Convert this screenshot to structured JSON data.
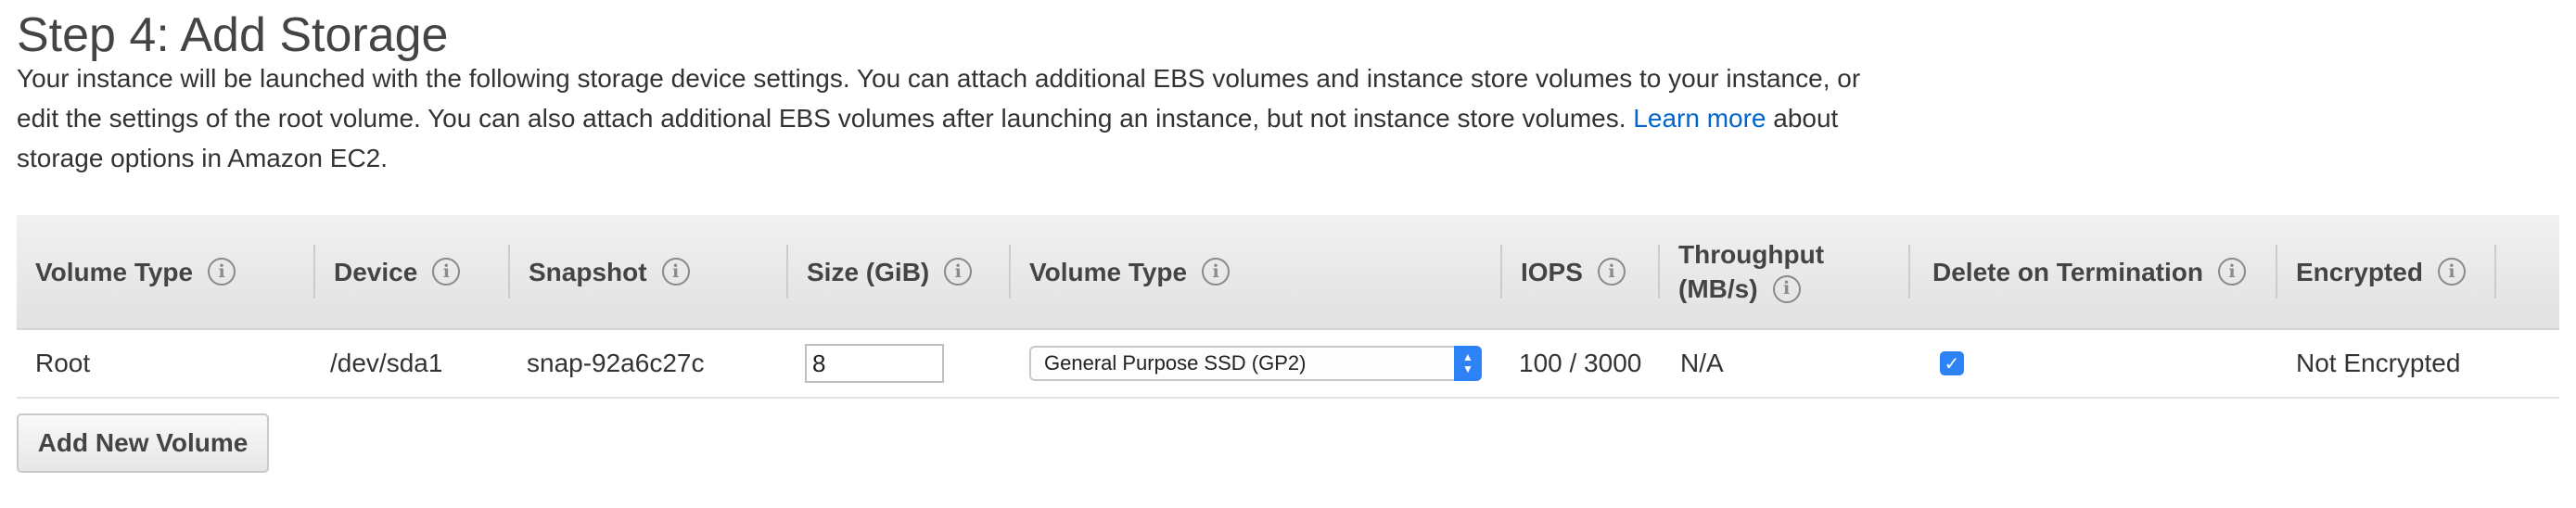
{
  "page": {
    "title": "Step 4: Add Storage",
    "description_line1": "Your instance will be launched with the following storage device settings. You can attach additional EBS volumes and instance store volumes to your instance, or",
    "description_line2_pre": "edit the settings of the root volume. You can also attach additional EBS volumes after launching an instance, but not instance store volumes.",
    "learn_more_link": "Learn more",
    "description_line2_post": "about",
    "description_line3": "storage options in Amazon EC2."
  },
  "table": {
    "headers": {
      "volume_type": "Volume Type",
      "device": "Device",
      "snapshot": "Snapshot",
      "size": "Size (GiB)",
      "volume_type_select": "Volume Type",
      "iops": "IOPS",
      "throughput_line1": "Throughput",
      "throughput_line2": "(MB/s)",
      "delete_on_termination": "Delete on Termination",
      "encrypted": "Encrypted"
    },
    "row": {
      "volume_type": "Root",
      "device": "/dev/sda1",
      "snapshot": "snap-92a6c27c",
      "size_value": "8",
      "volume_type_selected": "General Purpose SSD (GP2)",
      "iops": "100 / 3000",
      "throughput": "N/A",
      "delete_on_termination": true,
      "encrypted": "Not Encrypted"
    }
  },
  "icons": {
    "info": "info-icon",
    "select_arrows": "select-arrows-icon",
    "checkbox": "checkbox-checked-icon"
  },
  "actions": {
    "add_new_volume": "Add New Volume"
  },
  "colors": {
    "link": "#0066cc",
    "accent_blue": "#2d82f5",
    "header_bg": "#e8e8e8"
  }
}
